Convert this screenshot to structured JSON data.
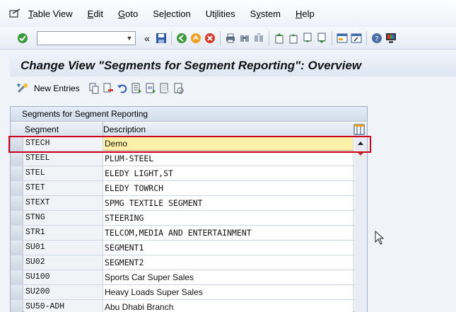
{
  "menu": {
    "items": [
      {
        "label": "Table View",
        "u": "T"
      },
      {
        "label": "Edit",
        "u": "E"
      },
      {
        "label": "Goto",
        "u": "G"
      },
      {
        "label": "Selection",
        "u": "l"
      },
      {
        "label": "Utilities",
        "u": "i"
      },
      {
        "label": "System",
        "u": "y"
      },
      {
        "label": "Help",
        "u": "H"
      }
    ]
  },
  "toolbar": {
    "command_value": ""
  },
  "title": "Change View \"Segments for Segment Reporting\": Overview",
  "app_toolbar": {
    "new_entries_label": "New Entries"
  },
  "table": {
    "title": "Segments for Segment Reporting",
    "columns": [
      "Segment",
      "Description"
    ],
    "rows": [
      {
        "segment": "STECH",
        "description": "Demo"
      },
      {
        "segment": "STEEL",
        "description": "PLUM-STEEL"
      },
      {
        "segment": "STEL",
        "description": "ELEDY LIGHT,ST"
      },
      {
        "segment": "STET",
        "description": "ELEDY TOWRCH"
      },
      {
        "segment": "STEXT",
        "description": "SPMG TEXTILE SEGMENT"
      },
      {
        "segment": "STNG",
        "description": "STEERING"
      },
      {
        "segment": "STR1",
        "description": "TELCOM,MEDIA AND ENTERTAINMENT"
      },
      {
        "segment": "SU01",
        "description": "SEGMENT1"
      },
      {
        "segment": "SU02",
        "description": "SEGMENT2"
      },
      {
        "segment": "SU100",
        "description": "Sports Car Super Sales"
      },
      {
        "segment": "SU200",
        "description": "Heavy Loads Super Sales"
      },
      {
        "segment": "SU50-ADH",
        "description": "Abu Dhabi Branch"
      }
    ]
  },
  "colors": {
    "highlight": "#d0021b",
    "active_row": "#fff1a8"
  }
}
